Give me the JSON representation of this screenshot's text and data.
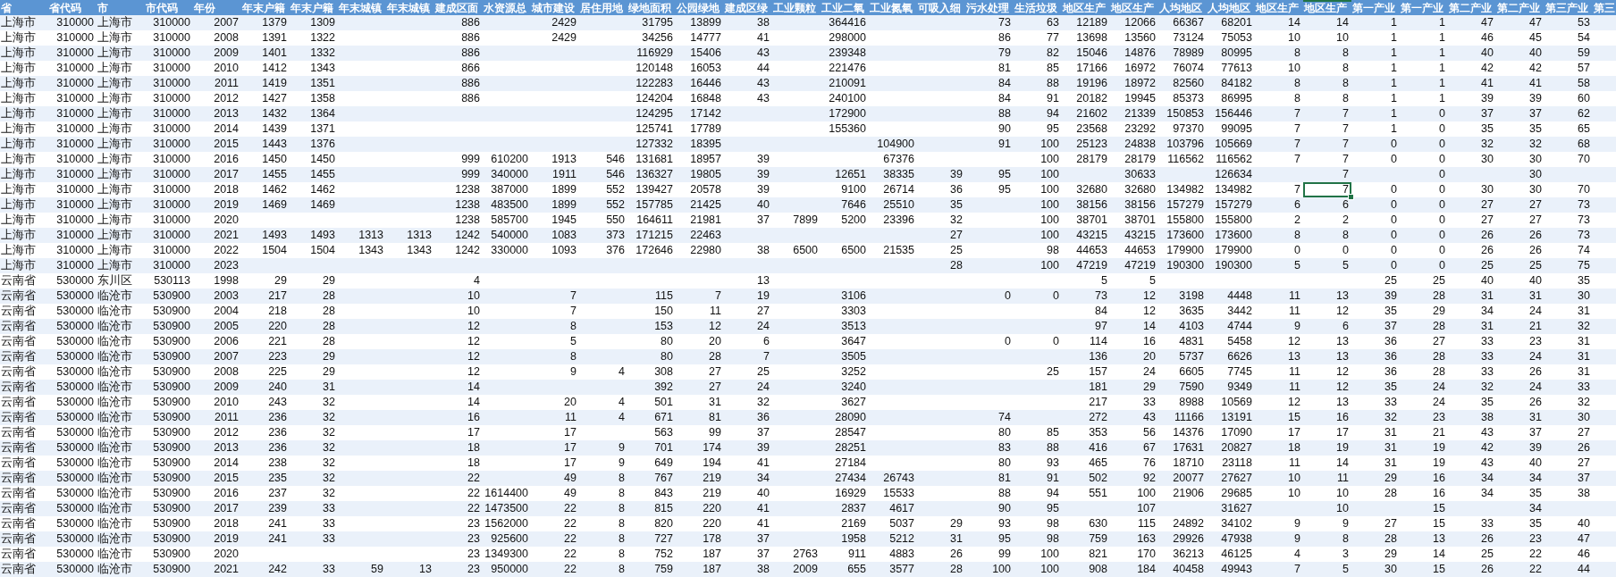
{
  "table": {
    "columns": [
      {
        "label": "省",
        "kind": "text",
        "selected": false
      },
      {
        "label": "省代码",
        "kind": "number",
        "selected": false
      },
      {
        "label": "市",
        "kind": "text",
        "selected": false
      },
      {
        "label": "市代码",
        "kind": "number",
        "selected": false
      },
      {
        "label": "年份",
        "kind": "number",
        "selected": false
      },
      {
        "label": "年末户籍",
        "kind": "number",
        "selected": false
      },
      {
        "label": "年末户籍",
        "kind": "number",
        "selected": false
      },
      {
        "label": "年末城镇",
        "kind": "number",
        "selected": false
      },
      {
        "label": "年末城镇",
        "kind": "number",
        "selected": false
      },
      {
        "label": "建成区面",
        "kind": "number",
        "selected": false
      },
      {
        "label": "水资源总",
        "kind": "number",
        "selected": false
      },
      {
        "label": "城市建设",
        "kind": "number",
        "selected": false
      },
      {
        "label": "居住用地",
        "kind": "number",
        "selected": false
      },
      {
        "label": "绿地面积",
        "kind": "number",
        "selected": false
      },
      {
        "label": "公园绿地",
        "kind": "number",
        "selected": false
      },
      {
        "label": "建成区绿",
        "kind": "number",
        "selected": false
      },
      {
        "label": "工业颗粒",
        "kind": "number",
        "selected": false
      },
      {
        "label": "工业二氧",
        "kind": "number",
        "selected": false
      },
      {
        "label": "工业氮氧",
        "kind": "number",
        "selected": false
      },
      {
        "label": "可吸入细",
        "kind": "number",
        "selected": false
      },
      {
        "label": "污水处理",
        "kind": "number",
        "selected": false
      },
      {
        "label": "生活垃圾",
        "kind": "number",
        "selected": false
      },
      {
        "label": "地区生产",
        "kind": "number",
        "selected": false
      },
      {
        "label": "地区生产",
        "kind": "number",
        "selected": false
      },
      {
        "label": "人均地区",
        "kind": "number",
        "selected": false
      },
      {
        "label": "人均地区",
        "kind": "number",
        "selected": false
      },
      {
        "label": "地区生产",
        "kind": "number",
        "selected": false
      },
      {
        "label": "地区生产",
        "kind": "number",
        "selected": true
      },
      {
        "label": "第一产业",
        "kind": "number",
        "selected": false
      },
      {
        "label": "第一产业",
        "kind": "number",
        "selected": false
      },
      {
        "label": "第二产业",
        "kind": "number",
        "selected": false
      },
      {
        "label": "第二产业",
        "kind": "number",
        "selected": false
      },
      {
        "label": "第三产业",
        "kind": "number",
        "selected": false
      },
      {
        "label": "第三",
        "kind": "number",
        "selected": false
      }
    ],
    "rows": [
      {
        "selected": false,
        "cells": [
          "上海市",
          "310000",
          "上海市",
          "310000",
          "2007",
          "1379",
          "1309",
          null,
          null,
          "886",
          null,
          "2429",
          null,
          "31795",
          "13899",
          "38",
          null,
          "364416",
          null,
          null,
          "73",
          "63",
          "12189",
          "12066",
          "66367",
          "68201",
          "14",
          "14",
          "1",
          "1",
          "47",
          "47",
          "53"
        ]
      },
      {
        "selected": false,
        "cells": [
          "上海市",
          "310000",
          "上海市",
          "310000",
          "2008",
          "1391",
          "1322",
          null,
          null,
          "886",
          null,
          "2429",
          null,
          "34256",
          "14777",
          "41",
          null,
          "298000",
          null,
          null,
          "86",
          "77",
          "13698",
          "13560",
          "73124",
          "75053",
          "10",
          "10",
          "1",
          "1",
          "46",
          "45",
          "54"
        ]
      },
      {
        "selected": false,
        "cells": [
          "上海市",
          "310000",
          "上海市",
          "310000",
          "2009",
          "1401",
          "1332",
          null,
          null,
          "886",
          null,
          null,
          null,
          "116929",
          "15406",
          "43",
          null,
          "239348",
          null,
          null,
          "79",
          "82",
          "15046",
          "14876",
          "78989",
          "80995",
          "8",
          "8",
          "1",
          "1",
          "40",
          "40",
          "59"
        ]
      },
      {
        "selected": false,
        "cells": [
          "上海市",
          "310000",
          "上海市",
          "310000",
          "2010",
          "1412",
          "1343",
          null,
          null,
          "866",
          null,
          null,
          null,
          "120148",
          "16053",
          "44",
          null,
          "221476",
          null,
          null,
          "81",
          "85",
          "17166",
          "16972",
          "76074",
          "77613",
          "10",
          "8",
          "1",
          "1",
          "42",
          "42",
          "57"
        ]
      },
      {
        "selected": false,
        "cells": [
          "上海市",
          "310000",
          "上海市",
          "310000",
          "2011",
          "1419",
          "1351",
          null,
          null,
          "886",
          null,
          null,
          null,
          "122283",
          "16446",
          "43",
          null,
          "210091",
          null,
          null,
          "84",
          "88",
          "19196",
          "18972",
          "82560",
          "84182",
          "8",
          "8",
          "1",
          "1",
          "41",
          "41",
          "58"
        ]
      },
      {
        "selected": false,
        "cells": [
          "上海市",
          "310000",
          "上海市",
          "310000",
          "2012",
          "1427",
          "1358",
          null,
          null,
          "886",
          null,
          null,
          null,
          "124204",
          "16848",
          "43",
          null,
          "240100",
          null,
          null,
          "84",
          "91",
          "20182",
          "19945",
          "85373",
          "86995",
          "8",
          "8",
          "1",
          "1",
          "39",
          "39",
          "60"
        ]
      },
      {
        "selected": false,
        "cells": [
          "上海市",
          "310000",
          "上海市",
          "310000",
          "2013",
          "1432",
          "1364",
          null,
          null,
          null,
          null,
          null,
          null,
          "124295",
          "17142",
          null,
          null,
          "172900",
          null,
          null,
          "88",
          "94",
          "21602",
          "21339",
          "150853",
          "156446",
          "7",
          "7",
          "1",
          "0",
          "37",
          "37",
          "62"
        ]
      },
      {
        "selected": false,
        "cells": [
          "上海市",
          "310000",
          "上海市",
          "310000",
          "2014",
          "1439",
          "1371",
          null,
          null,
          null,
          null,
          null,
          null,
          "125741",
          "17789",
          null,
          null,
          "155360",
          null,
          null,
          "90",
          "95",
          "23568",
          "23292",
          "97370",
          "99095",
          "7",
          "7",
          "1",
          "0",
          "35",
          "35",
          "65"
        ]
      },
      {
        "selected": false,
        "cells": [
          "上海市",
          "310000",
          "上海市",
          "310000",
          "2015",
          "1443",
          "1376",
          null,
          null,
          null,
          null,
          null,
          null,
          "127332",
          "18395",
          null,
          null,
          null,
          "104900",
          null,
          "91",
          "100",
          "25123",
          "24838",
          "103796",
          "105669",
          "7",
          "7",
          "0",
          "0",
          "32",
          "32",
          "68"
        ]
      },
      {
        "selected": false,
        "cells": [
          "上海市",
          "310000",
          "上海市",
          "310000",
          "2016",
          "1450",
          "1450",
          null,
          null,
          "999",
          "610200",
          "1913",
          "546",
          "131681",
          "18957",
          "39",
          null,
          null,
          "67376",
          null,
          null,
          "100",
          "28179",
          "28179",
          "116562",
          "116562",
          "7",
          "7",
          "0",
          "0",
          "30",
          "30",
          "70"
        ]
      },
      {
        "selected": false,
        "cells": [
          "上海市",
          "310000",
          "上海市",
          "310000",
          "2017",
          "1455",
          "1455",
          null,
          null,
          "999",
          "340000",
          "1911",
          "546",
          "136327",
          "19805",
          "39",
          null,
          "12651",
          "38335",
          "39",
          "95",
          "100",
          null,
          "30633",
          null,
          "126634",
          null,
          "7",
          null,
          "0",
          null,
          "30",
          null
        ]
      },
      {
        "selected": true,
        "cells": [
          "上海市",
          "310000",
          "上海市",
          "310000",
          "2018",
          "1462",
          "1462",
          null,
          null,
          "1238",
          "387000",
          "1899",
          "552",
          "139427",
          "20578",
          "39",
          null,
          "9100",
          "26714",
          "36",
          "95",
          "100",
          "32680",
          "32680",
          "134982",
          "134982",
          "7",
          "7",
          "0",
          "0",
          "30",
          "30",
          "70"
        ]
      },
      {
        "selected": false,
        "cells": [
          "上海市",
          "310000",
          "上海市",
          "310000",
          "2019",
          "1469",
          "1469",
          null,
          null,
          "1238",
          "483500",
          "1899",
          "552",
          "157785",
          "21425",
          "40",
          null,
          "7646",
          "25510",
          "35",
          null,
          "100",
          "38156",
          "38156",
          "157279",
          "157279",
          "6",
          "6",
          "0",
          "0",
          "27",
          "27",
          "73"
        ]
      },
      {
        "selected": false,
        "cells": [
          "上海市",
          "310000",
          "上海市",
          "310000",
          "2020",
          null,
          null,
          null,
          null,
          "1238",
          "585700",
          "1945",
          "550",
          "164611",
          "21981",
          "37",
          "7899",
          "5200",
          "23396",
          "32",
          null,
          "100",
          "38701",
          "38701",
          "155800",
          "155800",
          "2",
          "2",
          "0",
          "0",
          "27",
          "27",
          "73"
        ]
      },
      {
        "selected": false,
        "cells": [
          "上海市",
          "310000",
          "上海市",
          "310000",
          "2021",
          "1493",
          "1493",
          "1313",
          "1313",
          "1242",
          "540000",
          "1083",
          "373",
          "171215",
          "22463",
          null,
          null,
          null,
          null,
          "27",
          null,
          "100",
          "43215",
          "43215",
          "173600",
          "173600",
          "8",
          "8",
          "0",
          "0",
          "26",
          "26",
          "73"
        ]
      },
      {
        "selected": false,
        "cells": [
          "上海市",
          "310000",
          "上海市",
          "310000",
          "2022",
          "1504",
          "1504",
          "1343",
          "1343",
          "1242",
          "330000",
          "1093",
          "376",
          "172646",
          "22980",
          "38",
          "6500",
          "6500",
          "21535",
          "25",
          null,
          "98",
          "44653",
          "44653",
          "179900",
          "179900",
          "0",
          "0",
          "0",
          "0",
          "26",
          "26",
          "74"
        ]
      },
      {
        "selected": false,
        "cells": [
          "上海市",
          "310000",
          "上海市",
          "310000",
          "2023",
          null,
          null,
          null,
          null,
          null,
          null,
          null,
          null,
          null,
          null,
          null,
          null,
          null,
          null,
          "28",
          null,
          "100",
          "47219",
          "47219",
          "190300",
          "190300",
          "5",
          "5",
          "0",
          "0",
          "25",
          "25",
          "75"
        ]
      },
      {
        "selected": false,
        "cells": [
          "云南省",
          "530000",
          "东川区",
          "530113",
          "1998",
          "29",
          "29",
          null,
          null,
          "4",
          null,
          null,
          null,
          null,
          null,
          "13",
          null,
          null,
          null,
          null,
          null,
          null,
          "5",
          "5",
          null,
          null,
          null,
          null,
          "25",
          "25",
          "40",
          "40",
          "35"
        ]
      },
      {
        "selected": false,
        "cells": [
          "云南省",
          "530000",
          "临沧市",
          "530900",
          "2003",
          "217",
          "28",
          null,
          null,
          "10",
          null,
          "7",
          null,
          "115",
          "7",
          "19",
          null,
          "3106",
          null,
          null,
          "0",
          "0",
          "73",
          "12",
          "3198",
          "4448",
          "11",
          "13",
          "39",
          "28",
          "31",
          "31",
          "30"
        ]
      },
      {
        "selected": false,
        "cells": [
          "云南省",
          "530000",
          "临沧市",
          "530900",
          "2004",
          "218",
          "28",
          null,
          null,
          "10",
          null,
          "7",
          null,
          "150",
          "11",
          "27",
          null,
          "3303",
          null,
          null,
          null,
          null,
          "84",
          "12",
          "3635",
          "3442",
          "11",
          "12",
          "35",
          "29",
          "34",
          "24",
          "31"
        ]
      },
      {
        "selected": false,
        "cells": [
          "云南省",
          "530000",
          "临沧市",
          "530900",
          "2005",
          "220",
          "28",
          null,
          null,
          "12",
          null,
          "8",
          null,
          "153",
          "12",
          "24",
          null,
          "3513",
          null,
          null,
          null,
          null,
          "97",
          "14",
          "4103",
          "4744",
          "9",
          "6",
          "37",
          "28",
          "31",
          "21",
          "32"
        ]
      },
      {
        "selected": false,
        "cells": [
          "云南省",
          "530000",
          "临沧市",
          "530900",
          "2006",
          "221",
          "28",
          null,
          null,
          "12",
          null,
          "5",
          null,
          "80",
          "20",
          "6",
          null,
          "3647",
          null,
          null,
          "0",
          "0",
          "114",
          "16",
          "4831",
          "5458",
          "12",
          "13",
          "36",
          "27",
          "33",
          "23",
          "31"
        ]
      },
      {
        "selected": false,
        "cells": [
          "云南省",
          "530000",
          "临沧市",
          "530900",
          "2007",
          "223",
          "29",
          null,
          null,
          "12",
          null,
          "8",
          null,
          "80",
          "28",
          "7",
          null,
          "3505",
          null,
          null,
          null,
          null,
          "136",
          "20",
          "5737",
          "6626",
          "13",
          "13",
          "36",
          "28",
          "33",
          "24",
          "31"
        ]
      },
      {
        "selected": false,
        "cells": [
          "云南省",
          "530000",
          "临沧市",
          "530900",
          "2008",
          "225",
          "29",
          null,
          null,
          "12",
          null,
          "9",
          "4",
          "308",
          "27",
          "25",
          null,
          "3252",
          null,
          null,
          null,
          "25",
          "157",
          "24",
          "6605",
          "7745",
          "11",
          "12",
          "36",
          "28",
          "33",
          "26",
          "31"
        ]
      },
      {
        "selected": false,
        "cells": [
          "云南省",
          "530000",
          "临沧市",
          "530900",
          "2009",
          "240",
          "31",
          null,
          null,
          "14",
          null,
          null,
          null,
          "392",
          "27",
          "24",
          null,
          "3240",
          null,
          null,
          null,
          null,
          "181",
          "29",
          "7590",
          "9349",
          "11",
          "12",
          "35",
          "24",
          "32",
          "24",
          "33"
        ]
      },
      {
        "selected": false,
        "cells": [
          "云南省",
          "530000",
          "临沧市",
          "530900",
          "2010",
          "243",
          "32",
          null,
          null,
          "14",
          null,
          "20",
          "4",
          "501",
          "31",
          "32",
          null,
          "3627",
          null,
          null,
          null,
          null,
          "217",
          "33",
          "8988",
          "10569",
          "12",
          "13",
          "33",
          "24",
          "35",
          "26",
          "32"
        ]
      },
      {
        "selected": false,
        "cells": [
          "云南省",
          "530000",
          "临沧市",
          "530900",
          "2011",
          "236",
          "32",
          null,
          null,
          "16",
          null,
          "11",
          "4",
          "671",
          "81",
          "36",
          null,
          "28090",
          null,
          null,
          "74",
          null,
          "272",
          "43",
          "11166",
          "13191",
          "15",
          "16",
          "32",
          "23",
          "38",
          "31",
          "30"
        ]
      },
      {
        "selected": false,
        "cells": [
          "云南省",
          "530000",
          "临沧市",
          "530900",
          "2012",
          "236",
          "32",
          null,
          null,
          "17",
          null,
          "17",
          null,
          "563",
          "99",
          "37",
          null,
          "28547",
          null,
          null,
          "80",
          "85",
          "353",
          "56",
          "14376",
          "17090",
          "17",
          "17",
          "31",
          "21",
          "43",
          "37",
          "27"
        ]
      },
      {
        "selected": false,
        "cells": [
          "云南省",
          "530000",
          "临沧市",
          "530900",
          "2013",
          "236",
          "32",
          null,
          null,
          "18",
          null,
          "17",
          "9",
          "701",
          "174",
          "39",
          null,
          "28251",
          null,
          null,
          "83",
          "88",
          "416",
          "67",
          "17631",
          "20827",
          "18",
          "19",
          "31",
          "19",
          "42",
          "39",
          "26"
        ]
      },
      {
        "selected": false,
        "cells": [
          "云南省",
          "530000",
          "临沧市",
          "530900",
          "2014",
          "238",
          "32",
          null,
          null,
          "18",
          null,
          "17",
          "9",
          "649",
          "194",
          "41",
          null,
          "27184",
          null,
          null,
          "80",
          "93",
          "465",
          "76",
          "18710",
          "23118",
          "11",
          "14",
          "31",
          "19",
          "43",
          "40",
          "27"
        ]
      },
      {
        "selected": false,
        "cells": [
          "云南省",
          "530000",
          "临沧市",
          "530900",
          "2015",
          "235",
          "32",
          null,
          null,
          "22",
          null,
          "49",
          "8",
          "767",
          "219",
          "34",
          null,
          "27434",
          "26743",
          null,
          "81",
          "91",
          "502",
          "92",
          "20077",
          "27627",
          "10",
          "11",
          "29",
          "16",
          "34",
          "34",
          "37"
        ]
      },
      {
        "selected": false,
        "cells": [
          "云南省",
          "530000",
          "临沧市",
          "530900",
          "2016",
          "237",
          "32",
          null,
          null,
          "22",
          "1614400",
          "49",
          "8",
          "843",
          "219",
          "40",
          null,
          "16929",
          "15533",
          null,
          "88",
          "94",
          "551",
          "100",
          "21906",
          "29685",
          "10",
          "10",
          "28",
          "16",
          "34",
          "35",
          "38"
        ]
      },
      {
        "selected": false,
        "cells": [
          "云南省",
          "530000",
          "临沧市",
          "530900",
          "2017",
          "239",
          "33",
          null,
          null,
          "22",
          "1473500",
          "22",
          "8",
          "815",
          "220",
          "41",
          null,
          "2837",
          "4617",
          null,
          "90",
          "95",
          null,
          "107",
          null,
          "31627",
          null,
          "10",
          null,
          "15",
          null,
          "34",
          null
        ]
      },
      {
        "selected": false,
        "cells": [
          "云南省",
          "530000",
          "临沧市",
          "530900",
          "2018",
          "241",
          "33",
          null,
          null,
          "23",
          "1562000",
          "22",
          "8",
          "820",
          "220",
          "41",
          null,
          "2169",
          "5037",
          "29",
          "93",
          "98",
          "630",
          "115",
          "24892",
          "34102",
          "9",
          "9",
          "27",
          "15",
          "33",
          "35",
          "40"
        ]
      },
      {
        "selected": false,
        "cells": [
          "云南省",
          "530000",
          "临沧市",
          "530900",
          "2019",
          "241",
          "33",
          null,
          null,
          "23",
          "925600",
          "22",
          "8",
          "727",
          "178",
          "37",
          null,
          "1958",
          "5212",
          "31",
          "95",
          "98",
          "759",
          "163",
          "29926",
          "47938",
          "9",
          "8",
          "28",
          "13",
          "26",
          "23",
          "47"
        ]
      },
      {
        "selected": false,
        "cells": [
          "云南省",
          "530000",
          "临沧市",
          "530900",
          "2020",
          null,
          null,
          null,
          null,
          "23",
          "1349300",
          "22",
          "8",
          "752",
          "187",
          "37",
          "2763",
          "911",
          "4883",
          "26",
          "99",
          "100",
          "821",
          "170",
          "36213",
          "46125",
          "4",
          "3",
          "29",
          "14",
          "25",
          "22",
          "46"
        ]
      },
      {
        "selected": false,
        "cells": [
          "云南省",
          "530000",
          "临沧市",
          "530900",
          "2021",
          "242",
          "33",
          "59",
          "13",
          "23",
          "950000",
          "22",
          "8",
          "759",
          "187",
          "38",
          "2009",
          "655",
          "3577",
          "28",
          "100",
          "100",
          "908",
          "184",
          "40458",
          "49943",
          "7",
          "5",
          "30",
          "15",
          "26",
          "22",
          "44"
        ]
      }
    ]
  }
}
